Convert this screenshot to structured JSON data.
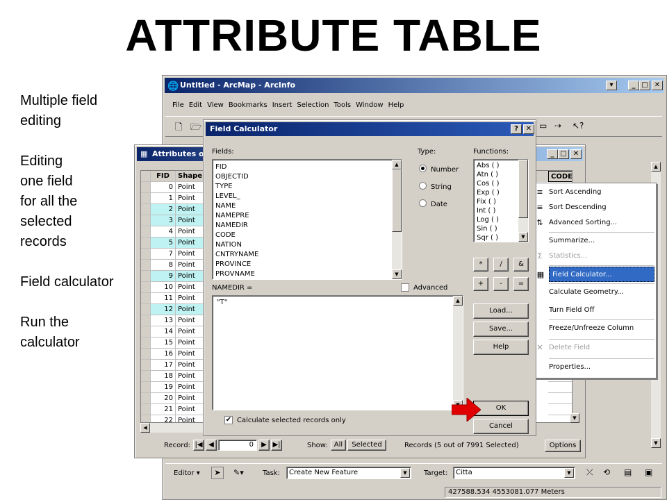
{
  "slide": {
    "title": "ATTRIBUTE TABLE",
    "notes": [
      [
        "Multiple field",
        "editing"
      ],
      [
        "Editing",
        "one field",
        "for all the",
        "selected",
        "records"
      ],
      [
        "Field calculator"
      ],
      [
        "Run the",
        "calculator"
      ]
    ]
  },
  "arcmap": {
    "title": "Untitled - ArcMap - ArcInfo",
    "menus": [
      "File",
      "Edit",
      "View",
      "Bookmarks",
      "Insert",
      "Selection",
      "Tools",
      "Window",
      "Help"
    ],
    "editor": {
      "editor_label": "Editor",
      "task_label": "Task:",
      "task_value": "Create New Feature",
      "target_label": "Target:",
      "target_value": "Citta"
    },
    "status_coords": "427588.534  4553081.077 Meters"
  },
  "attributes": {
    "title": "Attributes o",
    "columns": [
      "FID",
      "Shape",
      "CODE"
    ],
    "rows": [
      {
        "fid": "0",
        "shape": "Point",
        "selected": false
      },
      {
        "fid": "1",
        "shape": "Point",
        "selected": false
      },
      {
        "fid": "2",
        "shape": "Point",
        "selected": true
      },
      {
        "fid": "3",
        "shape": "Point",
        "selected": true
      },
      {
        "fid": "4",
        "shape": "Point",
        "selected": false
      },
      {
        "fid": "5",
        "shape": "Point",
        "selected": true
      },
      {
        "fid": "7",
        "shape": "Point",
        "selected": false
      },
      {
        "fid": "8",
        "shape": "Point",
        "selected": false
      },
      {
        "fid": "9",
        "shape": "Point",
        "selected": true
      },
      {
        "fid": "10",
        "shape": "Point",
        "selected": false
      },
      {
        "fid": "11",
        "shape": "Point",
        "selected": false
      },
      {
        "fid": "12",
        "shape": "Point",
        "selected": true
      },
      {
        "fid": "13",
        "shape": "Point",
        "selected": false
      },
      {
        "fid": "14",
        "shape": "Point",
        "selected": false
      },
      {
        "fid": "15",
        "shape": "Point",
        "selected": false
      },
      {
        "fid": "16",
        "shape": "Point",
        "selected": false
      },
      {
        "fid": "17",
        "shape": "Point",
        "selected": false
      },
      {
        "fid": "18",
        "shape": "Point",
        "selected": false
      },
      {
        "fid": "19",
        "shape": "Point",
        "selected": false
      },
      {
        "fid": "20",
        "shape": "Point",
        "selected": false
      },
      {
        "fid": "21",
        "shape": "Point",
        "selected": false
      },
      {
        "fid": "22",
        "shape": "Point",
        "selected": false
      }
    ],
    "footer": {
      "record_label": "Record:",
      "record_value": "0",
      "show_label": "Show:",
      "all_label": "All",
      "selected_label": "Selected",
      "records_text": "Records (5 out of 7991 Selected)",
      "options_label": "Options"
    }
  },
  "context_menu": {
    "items": [
      {
        "label": "Sort Ascending",
        "icon": "sort-ascending-icon",
        "glyph": "≡",
        "enabled": true,
        "highlighted": false
      },
      {
        "label": "Sort Descending",
        "icon": "sort-descending-icon",
        "glyph": "≡",
        "enabled": true,
        "highlighted": false
      },
      {
        "label": "Advanced Sorting...",
        "icon": "advanced-sort-icon",
        "glyph": "⇅",
        "enabled": true,
        "highlighted": false
      },
      {
        "label": "Summarize...",
        "icon": "",
        "glyph": "",
        "enabled": true,
        "highlighted": false
      },
      {
        "label": "Statistics...",
        "icon": "sigma-icon",
        "glyph": "Σ",
        "enabled": false,
        "highlighted": false
      },
      {
        "label": "Field Calculator...",
        "icon": "calculator-icon",
        "glyph": "▦",
        "enabled": true,
        "highlighted": true
      },
      {
        "label": "Calculate Geometry...",
        "icon": "",
        "glyph": "",
        "enabled": true,
        "highlighted": false
      },
      {
        "label": "Turn Field Off",
        "icon": "",
        "glyph": "",
        "enabled": true,
        "highlighted": false
      },
      {
        "label": "Freeze/Unfreeze Column",
        "icon": "",
        "glyph": "",
        "enabled": true,
        "highlighted": false
      },
      {
        "label": "Delete Field",
        "icon": "delete-icon",
        "glyph": "✕",
        "enabled": false,
        "highlighted": false
      },
      {
        "label": "Properties...",
        "icon": "",
        "glyph": "",
        "enabled": true,
        "highlighted": false
      }
    ],
    "highlight_color": "#316ac5"
  },
  "calculator": {
    "title": "Field Calculator",
    "fields_label": "Fields:",
    "fields": [
      "FID",
      "OBJECTID",
      "TYPE",
      "LEVEL_",
      "NAME",
      "NAMEPRE",
      "NAMEDIR",
      "CODE",
      "NATION",
      "CNTRYNAME",
      "PROVINCE",
      "PROVNAME"
    ],
    "type_label": "Type:",
    "types": [
      {
        "label": "Number",
        "checked": true
      },
      {
        "label": "String",
        "checked": false
      },
      {
        "label": "Date",
        "checked": false
      }
    ],
    "functions_label": "Functions:",
    "functions": [
      "Abs ( )",
      "Atn ( )",
      "Cos ( )",
      "Exp ( )",
      "Fix ( )",
      "Int ( )",
      "Log ( )",
      "Sin ( )",
      "Sqr ( )"
    ],
    "operators": [
      "*",
      "/",
      "&",
      "+",
      "-",
      "="
    ],
    "expression_label": "NAMEDIR =",
    "advanced_label": "Advanced",
    "expression": "\"T\"",
    "load_label": "Load...",
    "save_label": "Save...",
    "help_label": "Help",
    "calc_selected_label": "Calculate selected records only",
    "ok_label": "OK",
    "cancel_label": "Cancel"
  }
}
